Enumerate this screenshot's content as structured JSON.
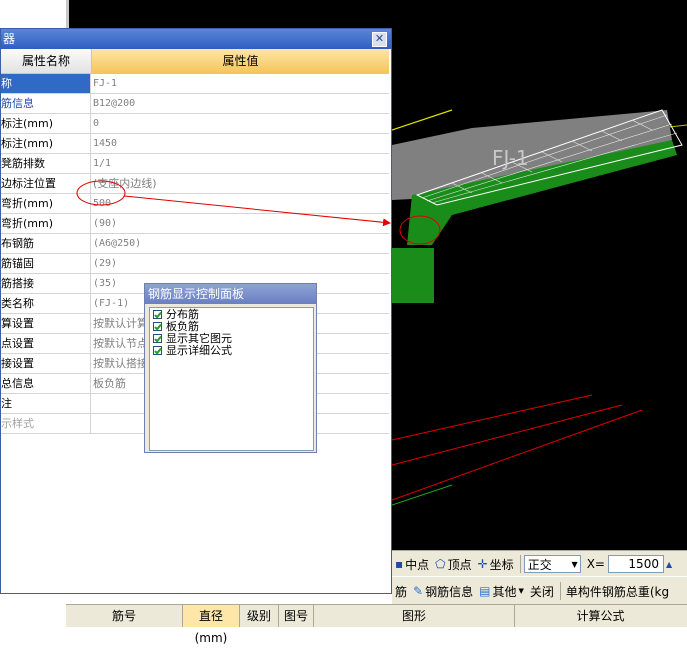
{
  "property_dialog": {
    "title": "器",
    "close_glyph": "✕",
    "header": {
      "name_col": "属性名称",
      "value_col": "属性值"
    },
    "rows": [
      {
        "name": "称",
        "value": "FJ-1"
      },
      {
        "name": "筋信息",
        "value": "B12@200"
      },
      {
        "name": "标注(mm)",
        "value": "0"
      },
      {
        "name": "标注(mm)",
        "value": "1450"
      },
      {
        "name": "凳筋排数",
        "value": "1/1"
      },
      {
        "name": "边标注位置",
        "value": "(支座内边线)"
      },
      {
        "name": "弯折(mm)",
        "value": "500"
      },
      {
        "name": "弯折(mm)",
        "value": "(90)"
      },
      {
        "name": "布钢筋",
        "value": "(A6@250)"
      },
      {
        "name": "筋锚固",
        "value": "(29)"
      },
      {
        "name": "筋搭接",
        "value": "(35)"
      },
      {
        "name": "类名称",
        "value": "(FJ-1)"
      },
      {
        "name": "算设置",
        "value": "按默认计算"
      },
      {
        "name": "点设置",
        "value": "按默认节点"
      },
      {
        "name": "接设置",
        "value": "按默认搭接"
      },
      {
        "name": "总信息",
        "value": "板负筋"
      },
      {
        "name": "注",
        "value": ""
      },
      {
        "name": "示样式",
        "value": ""
      }
    ]
  },
  "rebar_panel": {
    "title": "钢筋显示控制面板",
    "options": [
      {
        "label": "分布筋",
        "checked": true
      },
      {
        "label": "板负筋",
        "checked": true
      },
      {
        "label": "显示其它图元",
        "checked": true
      },
      {
        "label": "显示详细公式",
        "checked": true
      }
    ]
  },
  "snap_bar": {
    "midpoint": "中点",
    "vertex": "顶点",
    "coordinate": "坐标",
    "ortho": "正交",
    "x_label": "X=",
    "x_value": "1500"
  },
  "rebar_toolbar": {
    "rebar_partial": "筋",
    "rebar_info": "钢筋信息",
    "other": "其他",
    "close": "关闭",
    "total_weight": "单构件钢筋总重(kg"
  },
  "table_header": {
    "columns": [
      "筋号",
      "直径(mm)",
      "级别",
      "图号",
      "图形",
      "计算公式"
    ]
  },
  "viewport": {
    "label": "FJ-1"
  },
  "colors": {
    "annotation": "#e00000",
    "slab": "#20b020",
    "selection": "#316ac5"
  }
}
